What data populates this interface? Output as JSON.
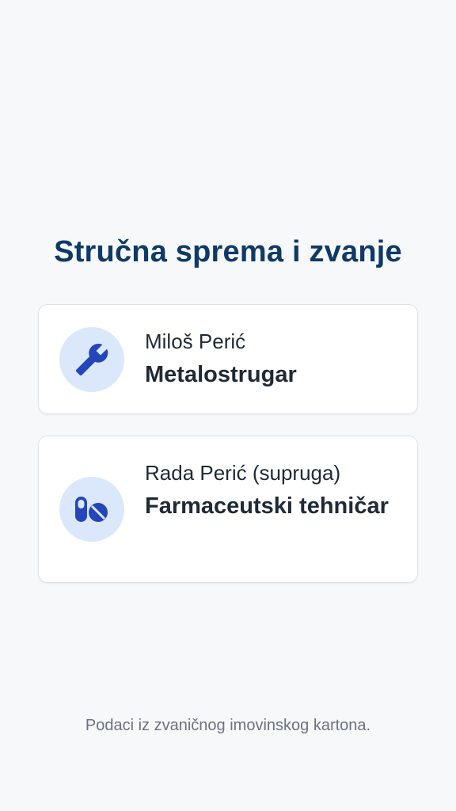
{
  "page": {
    "title": "Stručna sprema i zvanje",
    "footer": "Podaci iz zvaničnog imovinskog kartona."
  },
  "cards": [
    {
      "name": "Miloš Perić",
      "profession": "Metalostrugar",
      "icon": "wrench-icon"
    },
    {
      "name": "Rada Perić (supruga)",
      "profession": "Farmaceutski tehničar",
      "icon": "pills-icon"
    }
  ],
  "colors": {
    "title": "#0f3a66",
    "icon": "#2545b8",
    "icon_bg": "#dbe8fb",
    "background": "#f7f8fa"
  }
}
